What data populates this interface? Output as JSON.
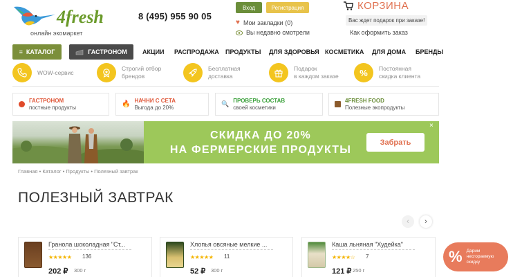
{
  "header": {
    "logo_text": "4fresh",
    "tagline": "онлайн экомаркет",
    "phone": "8 (495) 955 90 05",
    "login_label": "Вход",
    "register_label": "Регистрация",
    "bookmarks_label": "Мои закладки (0)",
    "recent_label": "Вы недавно смотрели",
    "cart_label": "КОРЗИНА",
    "gift_note": "Вас ждет подарок при заказе!",
    "how_to_order": "Как оформить заказ"
  },
  "nav": {
    "catalog_label": "КАТАЛОГ",
    "gastro_label": "ГАСТРОНОМ",
    "items": [
      "АКЦИИ",
      "РАСПРОДАЖА",
      "ПРОДУКТЫ",
      "ДЛЯ ЗДОРОВЬЯ",
      "КОСМЕТИКА",
      "ДЛЯ ДОМА",
      "БРЕНДЫ"
    ]
  },
  "features": [
    {
      "line1": "WOW-сервис",
      "line2": ""
    },
    {
      "line1": "Строгий отбор",
      "line2": "брендов"
    },
    {
      "line1": "Бесплатная",
      "line2": "доставка"
    },
    {
      "line1": "Подарок",
      "line2": "в каждом заказе"
    },
    {
      "line1": "Постоянная",
      "line2": "скидка клиента"
    }
  ],
  "promo_cards": [
    {
      "title": "ГАСТРОНОМ",
      "subtitle": "постные продукты",
      "title_color": "#e05a3c"
    },
    {
      "title": "НАЧНИ С СЕТА",
      "subtitle": "Выгода до 20%",
      "title_color": "#e05a3c"
    },
    {
      "title": "ПРОВЕРЬ СОСТАВ",
      "subtitle": "своей косметики",
      "title_color": "#3aa03a"
    },
    {
      "title": "4FRESH FOOD",
      "subtitle": "Полезные экопродукты",
      "title_color": "#6b8e3a"
    }
  ],
  "banner": {
    "line1": "СКИДКА ДО 20%",
    "line2": "НА ФЕРМЕРСКИЕ ПРОДУКТЫ",
    "button_label": "Забрать",
    "close": "×"
  },
  "breadcrumb": "Главная • Каталог • Продукты • Полезный завтрак",
  "page_title": "ПОЛЕЗНЫЙ ЗАВТРАК",
  "products": [
    {
      "name": "Гранола шоколадная \"Ст...",
      "stars": "★★★★★",
      "reviews": "136",
      "price": "202 ₽",
      "weight": "300 г"
    },
    {
      "name": "Хлопья овсяные мелкие ...",
      "stars": "★★★★★",
      "reviews": "11",
      "price": "52 ₽",
      "weight": "300 г"
    },
    {
      "name": "Каша льняная \"Худейка\"",
      "stars": "★★★★☆",
      "reviews": "7",
      "price": "121 ₽",
      "weight": "250 г"
    }
  ],
  "discount_badge": {
    "symbol": "%",
    "line1": "Дарим",
    "line2": "несгораемую",
    "line3": "скидку"
  },
  "colors": {
    "accent_green": "#7b8f3a",
    "accent_orange": "#e0704f",
    "banner_green": "#9dc85a",
    "feature_yellow": "#f3c51f"
  }
}
